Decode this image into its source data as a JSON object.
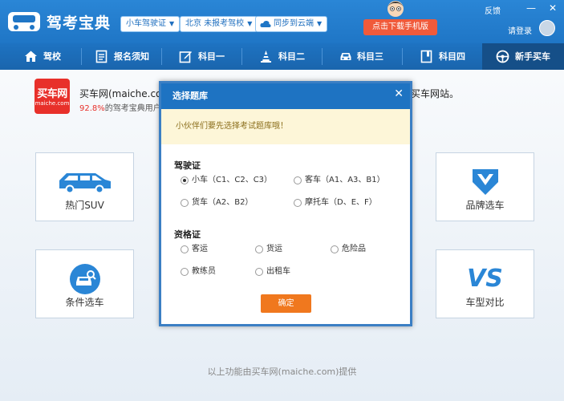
{
  "app": {
    "title": "驾考宝典",
    "license_type": "小车驾驶证",
    "location": "北京 未报考驾校",
    "sync": "同步到云端",
    "download_phone": "点击下载手机版",
    "feedback": "反馈",
    "login": "请登录",
    "min_glyph": "—",
    "close_glyph": "✕"
  },
  "nav": {
    "items": [
      "驾校",
      "报名须知",
      "科目一",
      "科目二",
      "科目三",
      "科目四",
      "新手买车"
    ],
    "active": "新手买车"
  },
  "maiche": {
    "logo_big": "买车网",
    "logo_small": "maiche.com",
    "line1": "买车网(maiche.com",
    "line1_right": "买车网站。",
    "pct": "92.8%",
    "line2": "的驾考宝典用户通"
  },
  "cards": {
    "hot_suv": "热门SUV",
    "condition": "条件选车",
    "brand": "品牌选车",
    "compare": "车型对比",
    "compare_vs": "VS"
  },
  "footer": "以上功能由买车网(maiche.com)提供",
  "dialog": {
    "title": "选择题库",
    "close": "✕",
    "notice": "小伙伴们要先选择考试题库哦！",
    "driver_section": "驾驶证",
    "driver_options": [
      "小车（C1、C2、C3）",
      "客车（A1、A3、B1）",
      "货车（A2、B2）",
      "摩托车（D、E、F）"
    ],
    "selected": "小车（C1、C2、C3）",
    "qual_section": "资格证",
    "qual_options": [
      "客运",
      "货运",
      "危险品",
      "教练员",
      "出租车"
    ],
    "confirm": "确定"
  },
  "colors": {
    "brand_blue": "#1f76c6",
    "download_red": "#f05a3a",
    "confirm_orange": "#f0781e",
    "maiche_red": "#e8302a"
  }
}
